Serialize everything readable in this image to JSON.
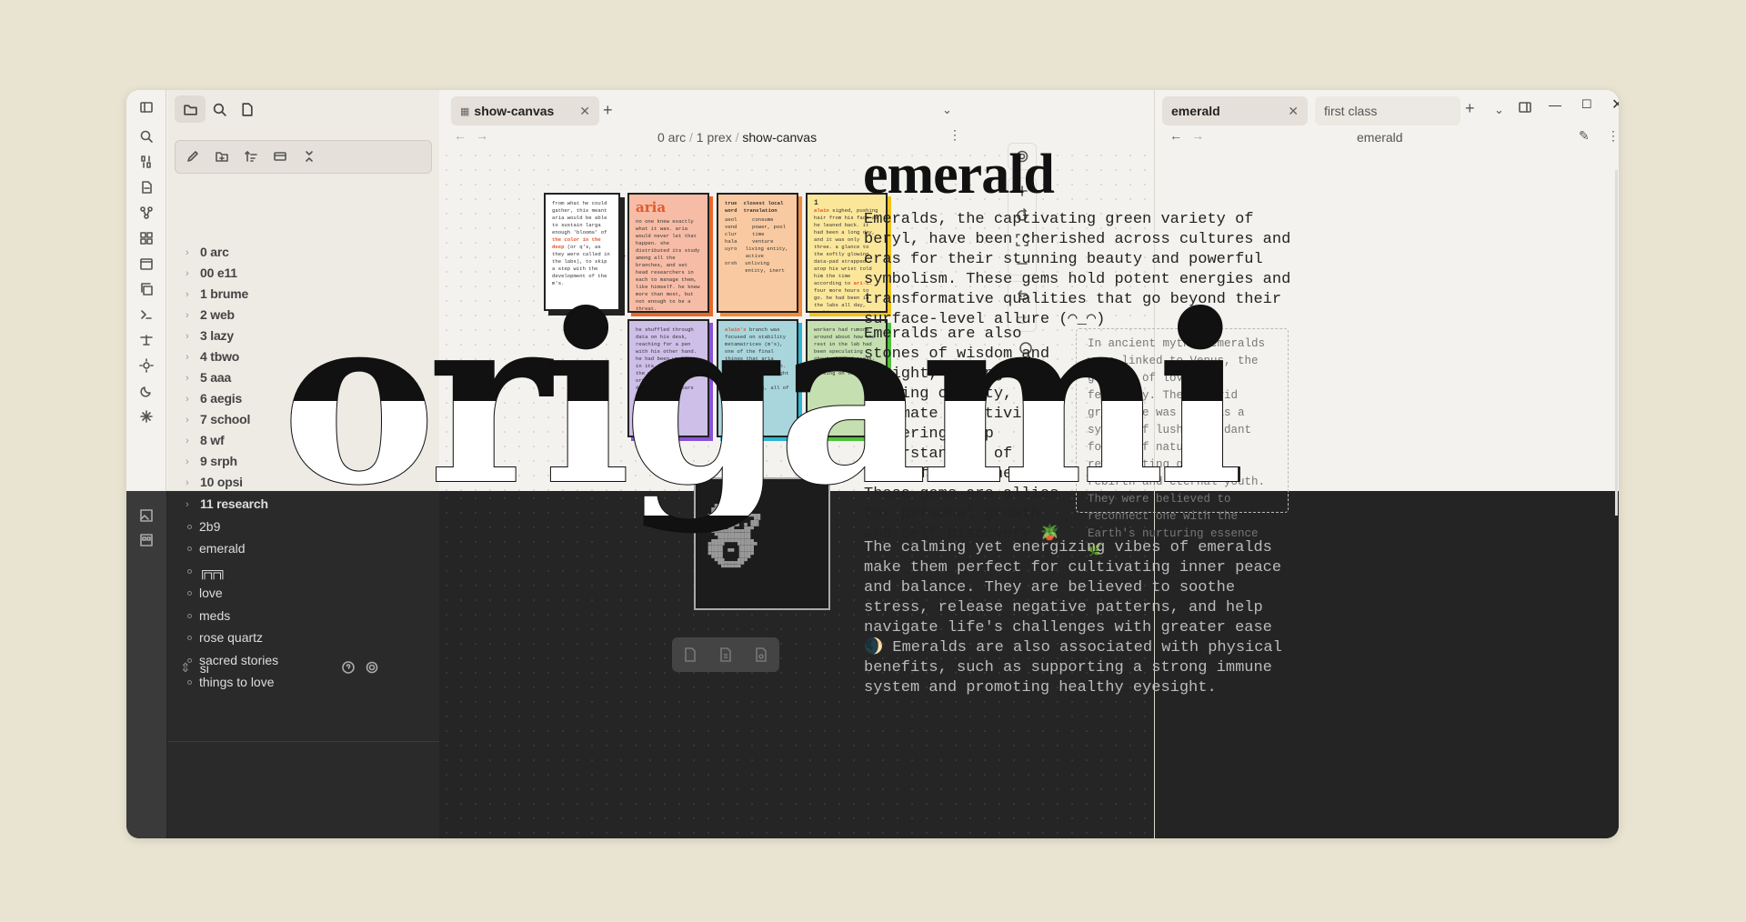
{
  "sidebar": {
    "folders": [
      "0 arc",
      "00 e11",
      "1 brume",
      "2 web",
      "3 lazy",
      "4 tbwo",
      "5 aaa",
      "6 aegis",
      "7 school",
      "8 wf",
      "9 srph",
      "10 opsi",
      "11 research"
    ],
    "files": [
      "2b9",
      "emerald",
      "╔╦╗",
      "love",
      "meds",
      "rose quartz",
      "sacred stories",
      "things to love"
    ],
    "vault": "si"
  },
  "canvas": {
    "tab_label": "show-canvas",
    "breadcrumb": [
      "0 arc",
      "1 prex",
      "show-canvas"
    ],
    "cards": {
      "c1": "from what he could gather, this meant aria would be able to sustain larga enough 'blooms' of",
      "c1_red": "the color in the deep",
      "c1_tail": "(or q's, as they were called in the labs), to skip a step with the development of the m's.",
      "aria_title": "aria",
      "aria_body": "no one knew exactly what it was. aria would never let that happen. she distributed its study among all the branches, and set head researchers in each to manage them, like himself. he knew more than most, but not enough to be a threat.",
      "tbl_h1": "true word",
      "tbl_h2": "closest local translation",
      "tbl_rows": [
        [
          "aeol",
          "consume"
        ],
        [
          "vend",
          "power, pool"
        ],
        [
          "clur",
          "time"
        ],
        [
          "hala",
          "venture"
        ],
        [
          "uyro",
          "living entity, active"
        ],
        [
          "orsh",
          "unliving entity, inert"
        ]
      ],
      "y_num": "1",
      "y_red": "alwin",
      "y_body": "sighed, pushing hair from his face as he leaned back. it had been a long day, and it was only three. a glance to the softly glowing data-pad strapped atop his wrist told him the time according to",
      "y_red2": "ari-1",
      "y_tail": ": four more hours to go. he had been in the labs all day, working on a report for his boss, aria.",
      "p_body": "he shuffled through data on his desk, reaching for a pen with his other hand. he had been working in its shadow, but the massive organization's disappearance years ago.",
      "b_red": "alwin's",
      "b_body": "branch was focused on stability metamatrices (m's), one of the final things that aria needed for her plan. the days aria brought forth were breakthroughs, all of them.",
      "g_body": "workers had rumors around about how the rest in the lab had been speculating about the bed areas. some said many were working on them.",
      "skull": "   ▄▄███████▄▄\n  ████████████▀\n ▀███▀▀▀████▀▀▀██\n ▐██  ▄ ▐█▌ ▄ ██▌\n  ██▄▄▄██▄▄▄██▀\n   ▀██████████\n ▄████▀▀▀▀█████▄\n ████▌ ▄▄ ▐████\n ▀███▌    ▐███▀\n   ▀██▄▄▄▄██▀\n     ▀▀▀▀▀▀"
    }
  },
  "note": {
    "tabs": [
      "emerald",
      "first class"
    ],
    "header_title": "emerald",
    "title": "emerald",
    "p1": "Emeralds, the captivating green variety of beryl, have been cherished across cultures and eras for their stunning beauty and powerful symbolism. These gems hold potent energies and transformative qualities that go beyond their surface-level allure (◠_◠)",
    "p2": "Emeralds are also stones of wisdom and insight, aiding in gaining clarity, ultimate creativity, fostering deep understanding of oneself and others. These gems are allies for personal growth and self-discovery 🪴",
    "callout": "In ancient myths, emeralds were linked to Venus, the goddess of love and fertility. Their vivid green hue was seen as a symbol of lush, abundant forces of nature, representing growth, rebirth and eternal youth. They were believed to reconnect one with the Earth's nurturing essence 🌿",
    "p3": "The calming yet energizing vibes of emeralds make them perfect for cultivating inner peace and balance. They are believed to soothe stress, release negative patterns, and help navigate life's challenges with greater ease 🌒 Emeralds are also associated with physical benefits, such as supporting a strong immune system and promoting healthy eyesight."
  },
  "hero_text": "origami"
}
